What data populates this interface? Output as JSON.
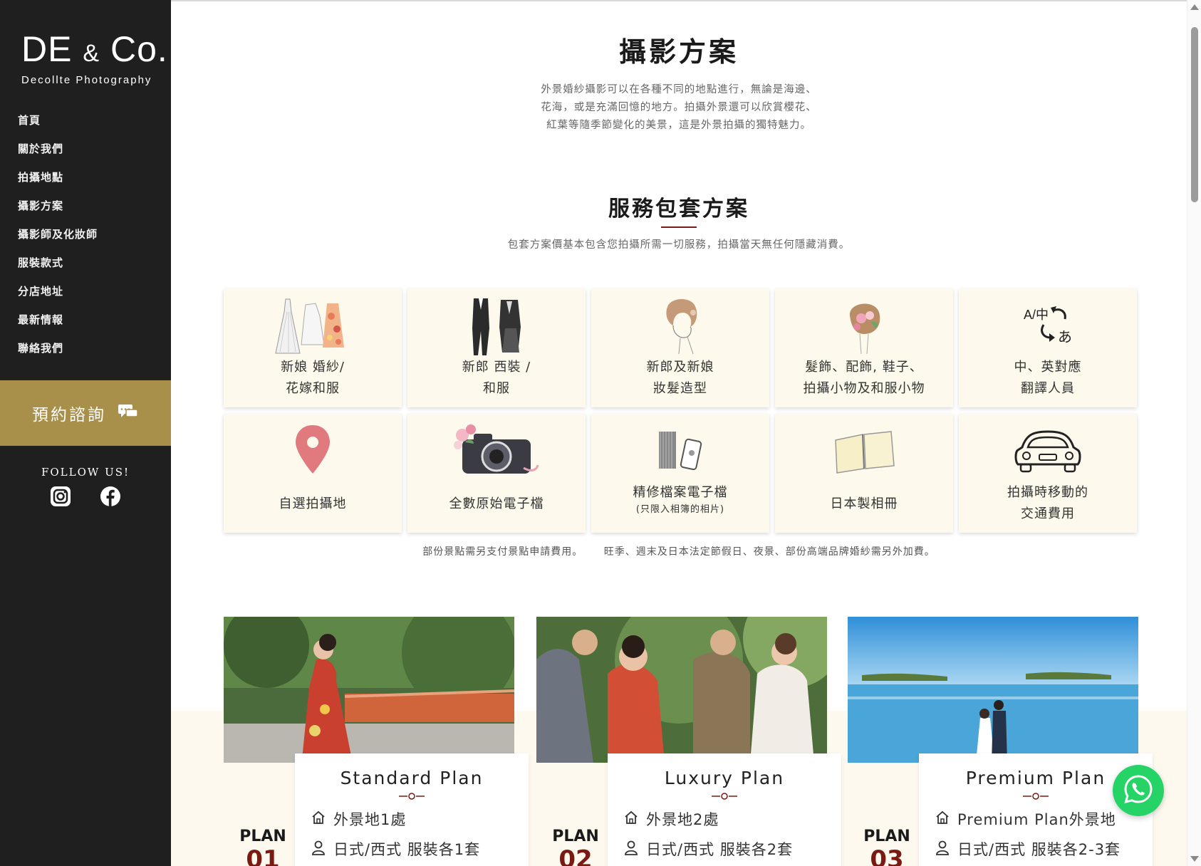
{
  "brand": {
    "name_de": "DE",
    "name_amp": "&",
    "name_co": "Co.",
    "subtitle": "Decollte Photography"
  },
  "nav": [
    "首頁",
    "關於我們",
    "拍攝地點",
    "攝影方案",
    "攝影師及化妝師",
    "服裝款式",
    "分店地址",
    "最新情報",
    "聯絡我們"
  ],
  "reserve": {
    "label": "預約諮詢",
    "icon": "chat-bubble-icon"
  },
  "follow": {
    "label": "FOLLOW US!",
    "icons": [
      "instagram-icon",
      "facebook-icon"
    ]
  },
  "page": {
    "title": "攝影方案",
    "intro": [
      "外景婚紗攝影可以在各種不同的地點進行，無論是海邊、",
      "花海，或是充滿回憶的地方。拍攝外景還可以欣賞櫻花、",
      "紅葉等隨季節變化的美景，這是外景拍攝的獨特魅力。"
    ]
  },
  "services": {
    "title": "服務包套方案",
    "desc": "包套方案價基本包含您拍攝所需一切服務，拍攝當天無任何隱藏消費。",
    "cards": [
      {
        "icon": "wedding-dress-icon",
        "line1": "新娘 婚紗/",
        "line2": "花嫁和服"
      },
      {
        "icon": "groom-suit-icon",
        "line1": "新郎 西裝 /",
        "line2": "和服"
      },
      {
        "icon": "bride-hair-icon",
        "line1": "新郎及新娘",
        "line2": "妝髮造型"
      },
      {
        "icon": "hair-accessory-icon",
        "line1": "髮飾、配飾, 鞋子、",
        "line2": "拍攝小物及和服小物"
      },
      {
        "icon": "translate-icon",
        "line1": "中、英對應",
        "line2": "翻譯人員"
      },
      {
        "icon": "location-pin-icon",
        "line1": "自選拍攝地",
        "line2": ""
      },
      {
        "icon": "camera-icon",
        "line1": "全數原始電子檔",
        "line2": ""
      },
      {
        "icon": "phone-album-icon",
        "line1": "精修檔案電子檔",
        "line2": "",
        "small": "(只限入相簿的相片)"
      },
      {
        "icon": "photo-album-icon",
        "line1": "日本製相冊",
        "line2": ""
      },
      {
        "icon": "car-icon",
        "line1": "拍攝時移動的",
        "line2": "交通費用"
      }
    ],
    "notes": [
      "部份景點需另支付景點申請費用。",
      "旺季、週末及日本法定節假日、夜景、部份高端品牌婚紗需另外加費。"
    ]
  },
  "plans": [
    {
      "tag": "PLAN",
      "num": "01",
      "name": "Standard Plan",
      "loc": "外景地1處",
      "outfit": "日式/西式 服裝各1套"
    },
    {
      "tag": "PLAN",
      "num": "02",
      "name": "Luxury Plan",
      "loc": "外景地2處",
      "outfit": "日式/西式 服裝各2套"
    },
    {
      "tag": "PLAN",
      "num": "03",
      "name": "Premium Plan",
      "loc": "Premium Plan外景地",
      "outfit": "日式/西式 服裝各2-3套"
    }
  ],
  "colors": {
    "sidebar": "#1f1f1f",
    "gold": "#a88f4a",
    "accent": "#7a1a12",
    "card": "#fdf9ec",
    "whatsapp": "#25d366"
  }
}
